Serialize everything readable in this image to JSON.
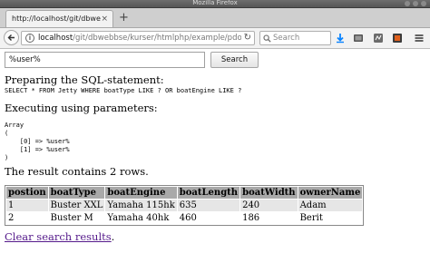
{
  "window": {
    "title": "Mozilla Firefox"
  },
  "tabs": [
    {
      "title": "http://localhost/git/dbwebbse/kurser/htmlphp/example/pdo-sqlite",
      "close": "×"
    }
  ],
  "newtab_label": "+",
  "navbar": {
    "url_host": "localhost",
    "url_path": "/git/dbwebbse/kurser/htmlphp/example/pdo-sqlit",
    "url_prefix": "",
    "search_placeholder": "Search",
    "info_glyph": "i",
    "reload_glyph": "↻"
  },
  "form": {
    "query_value": "%user%",
    "search_button": "Search"
  },
  "sections": {
    "prepare_heading": "Preparing the SQL-statement:",
    "sql": "SELECT * FROM Jetty WHERE boatType LIKE ? OR boatEngine LIKE ?",
    "execute_heading": "Executing using parameters:",
    "params_dump": "Array\n(\n    [0] => %user%\n    [1] => %user%\n)",
    "result_text": "The result contains 2 rows."
  },
  "table": {
    "columns": [
      "postion",
      "boatType",
      "boatEngine",
      "boatLength",
      "boatWidth",
      "ownerName"
    ],
    "rows": [
      [
        "1",
        "Buster XXL",
        "Yamaha 115hk",
        "635",
        "240",
        "Adam"
      ],
      [
        "2",
        "Buster M",
        "Yamaha 40hk",
        "460",
        "186",
        "Berit"
      ]
    ]
  },
  "clear_link": {
    "label": "Clear search results",
    "suffix": "."
  },
  "icons": {
    "back": "arrow-left-icon",
    "search": "magnifier-icon",
    "download": "download-arrow-icon",
    "screenshot": "screenshot-icon",
    "extension": "extension-icon",
    "extension2": "addon-icon",
    "menu": "hamburger-menu-icon"
  },
  "colors": {
    "link_visited": "#551a8b",
    "download_blue": "#0a84ff",
    "table_header": "#a9a9a9"
  }
}
